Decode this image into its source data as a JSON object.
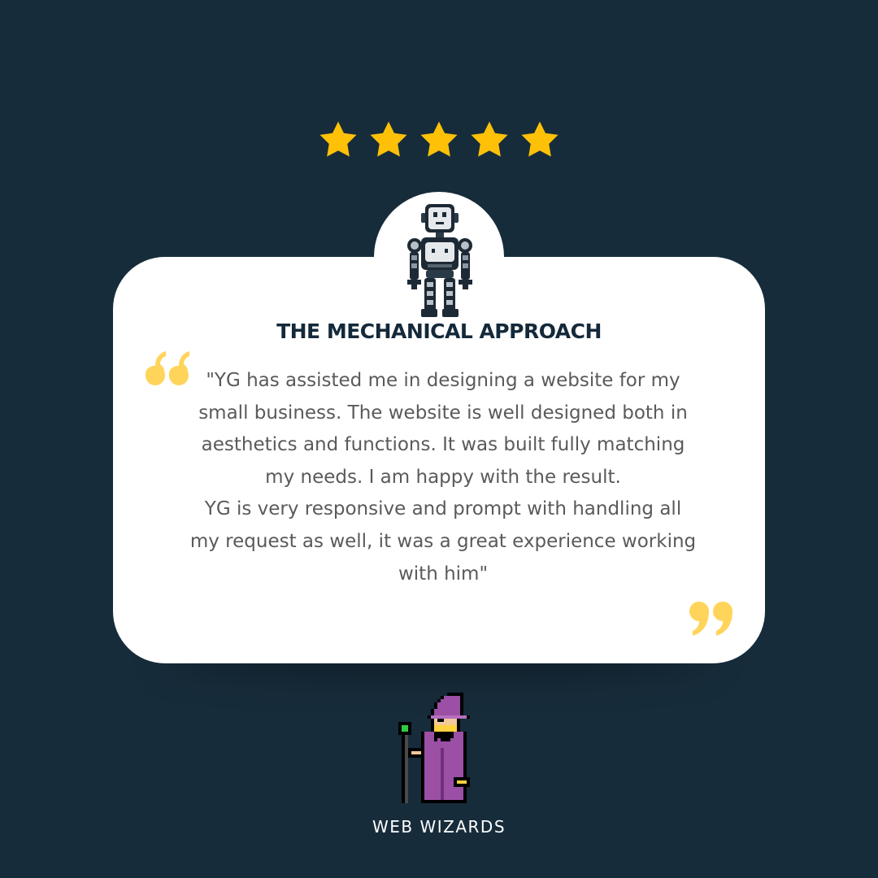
{
  "rating": {
    "stars_filled": 5,
    "stars_total": 5,
    "star_color": "#ffc107"
  },
  "card": {
    "avatar_icon": "robot-icon",
    "title": "THE MECHANICAL APPROACH",
    "quote_open_icon": "quote-open-icon",
    "quote_close_icon": "quote-close-icon",
    "quote_color": "#ffd45a",
    "testimonial": {
      "paragraph_1": "\"YG has assisted me in designing a website for my small business. The website is well designed both in aesthetics and functions. It was built fully matching my needs. I am happy with the result.",
      "paragraph_2": "YG is very responsive and prompt with handling all my request as well, it was a great experience working with him\""
    }
  },
  "footer": {
    "logo_icon": "wizard-icon",
    "brand_name": "WEB WIZARDS"
  },
  "colors": {
    "background": "#172c3b",
    "card": "#ffffff",
    "title": "#14293a",
    "text": "#5a5a5a"
  }
}
